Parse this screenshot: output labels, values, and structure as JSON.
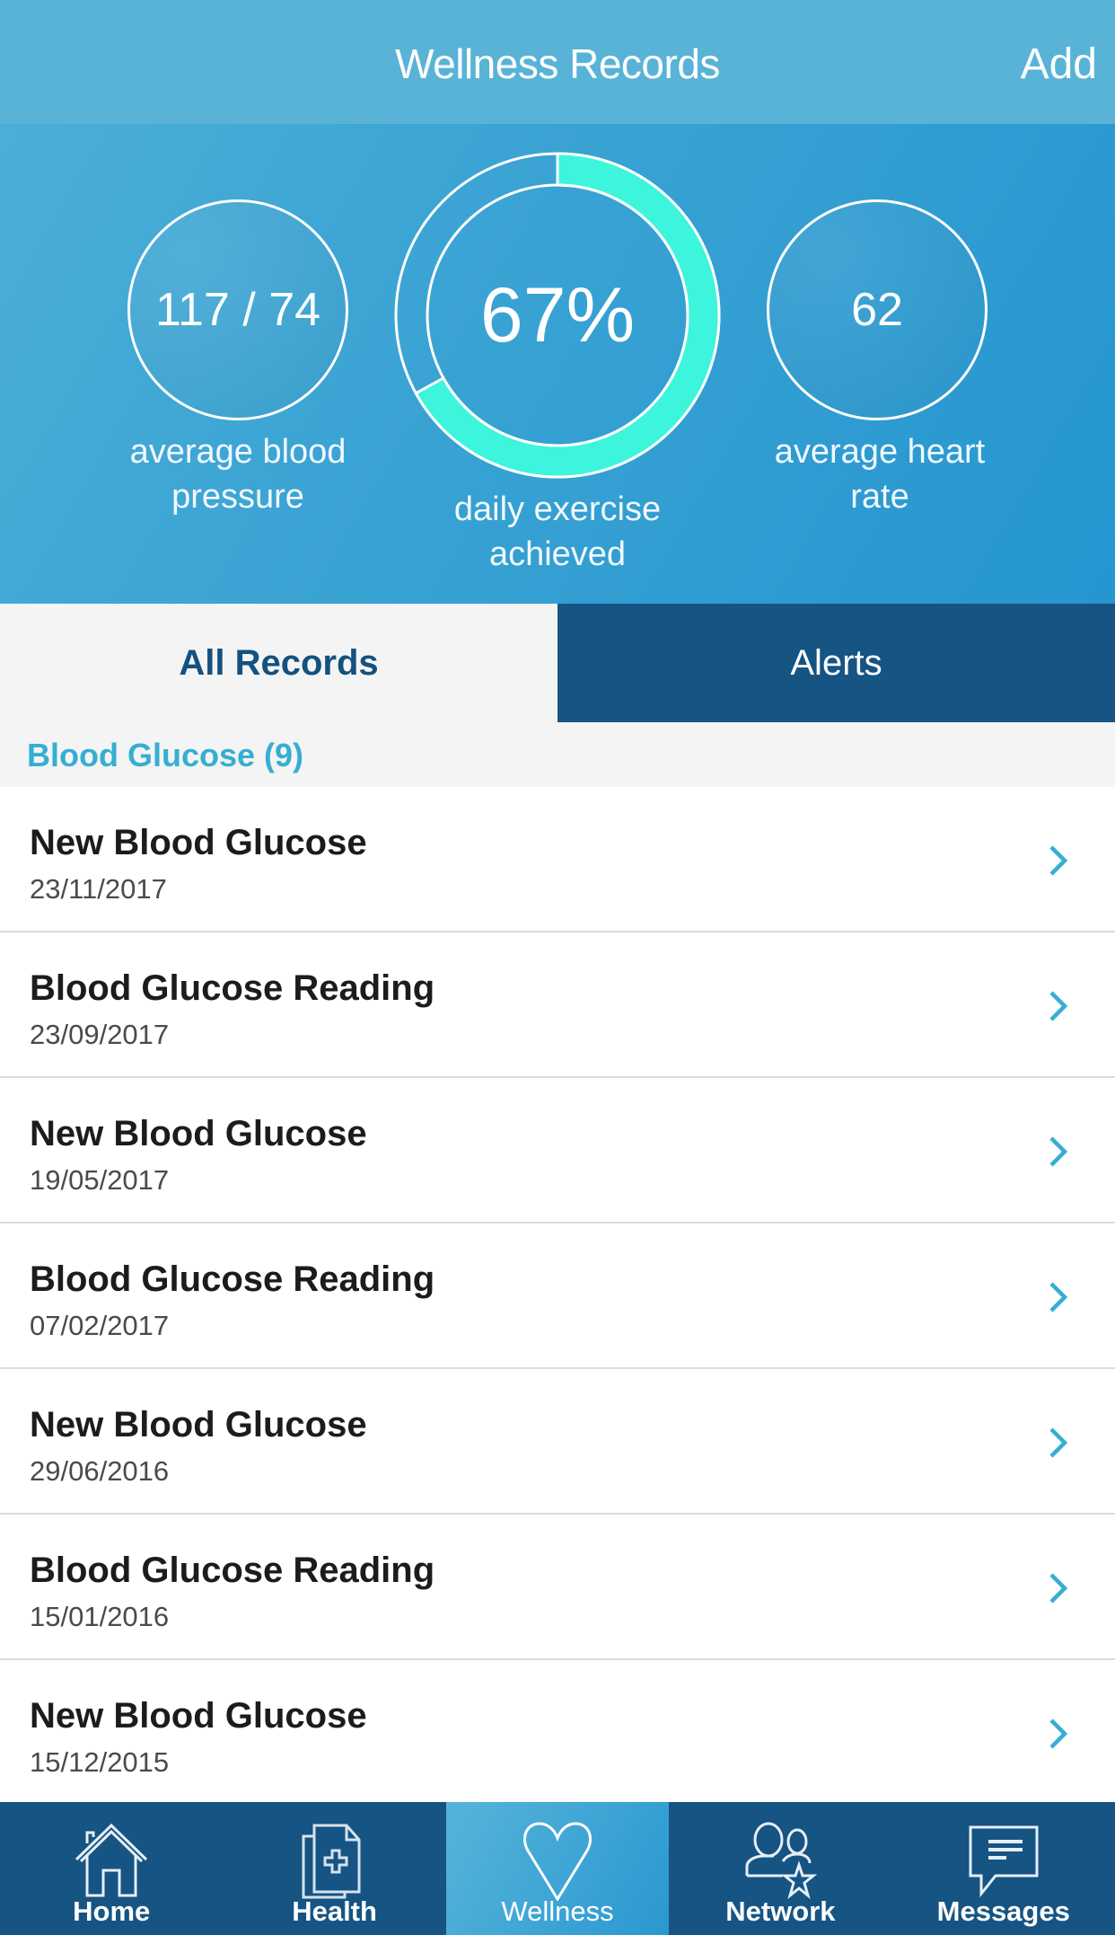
{
  "navbar": {
    "title": "Wellness Records",
    "add_label": "Add"
  },
  "stats": {
    "blood_pressure": {
      "value": "117 / 74",
      "label_line1": "average blood",
      "label_line2": "pressure"
    },
    "exercise": {
      "value": "67%",
      "progress_percent": 67,
      "label_line1": "daily exercise",
      "label_line2": "achieved"
    },
    "heart_rate": {
      "value": "62",
      "label": "average heart rate"
    }
  },
  "tabs": [
    {
      "label": "All Records",
      "active": true
    },
    {
      "label": "Alerts",
      "active": false
    }
  ],
  "section": {
    "title": "Blood Glucose (9)"
  },
  "records": [
    {
      "name": "New Blood Glucose",
      "date": "23/11/2017"
    },
    {
      "name": "Blood Glucose Reading",
      "date": "23/09/2017"
    },
    {
      "name": "New Blood Glucose",
      "date": "19/05/2017"
    },
    {
      "name": "Blood Glucose Reading",
      "date": "07/02/2017"
    },
    {
      "name": "New Blood Glucose",
      "date": "29/06/2016"
    },
    {
      "name": "Blood Glucose Reading",
      "date": "15/01/2016"
    },
    {
      "name": "New Blood Glucose",
      "date": "15/12/2015"
    }
  ],
  "tabbar": [
    {
      "label": "Home",
      "icon": "home-icon",
      "active": false
    },
    {
      "label": "Health",
      "icon": "health-record-icon",
      "active": false
    },
    {
      "label": "Wellness",
      "icon": "heart-icon",
      "active": true
    },
    {
      "label": "Network",
      "icon": "network-icon",
      "active": false
    },
    {
      "label": "Messages",
      "icon": "messages-icon",
      "active": false
    }
  ],
  "colors": {
    "navbar_bg": "#58b3d7",
    "accent_teal": "#3cf5dc",
    "dark_blue": "#155483",
    "section_title": "#36aed3",
    "chevron": "#36aed3"
  }
}
